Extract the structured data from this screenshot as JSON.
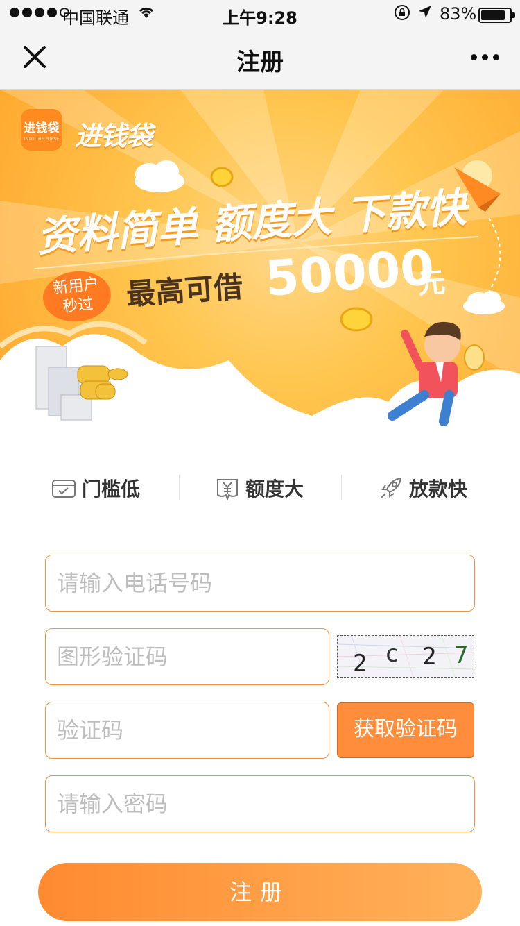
{
  "status_bar": {
    "carrier": "中国联通",
    "time": "上午9:28",
    "battery": "83%",
    "battery_level": 0.83,
    "signal_bars": 4
  },
  "nav": {
    "title": "注册",
    "close_icon": "close-icon",
    "more_icon": "more-icon"
  },
  "banner": {
    "logo_text": "进钱袋",
    "logo_sub": "INTO THE PURSE",
    "brand": "进钱袋",
    "headline": "资料简单  额度大  下款快",
    "badge_line1": "新用户",
    "badge_line2": "秒过",
    "max_label": "最高可借",
    "max_amount": "50000",
    "max_unit": "元"
  },
  "features": [
    {
      "label": "门槛低",
      "icon": "card-check-icon"
    },
    {
      "label": "额度大",
      "icon": "yen-bag-icon"
    },
    {
      "label": "放款快",
      "icon": "rocket-icon"
    }
  ],
  "form": {
    "phone_placeholder": "请输入电话号码",
    "captcha_placeholder": "图形验证码",
    "captcha_text": "2c27",
    "sms_placeholder": "验证码",
    "get_code_label": "获取验证码",
    "password_placeholder": "请输入密码",
    "submit_label": "注册"
  },
  "colors": {
    "accent": "#ff8d3b",
    "field_border": "#f0923d",
    "banner_bg": "#ffb83a"
  }
}
